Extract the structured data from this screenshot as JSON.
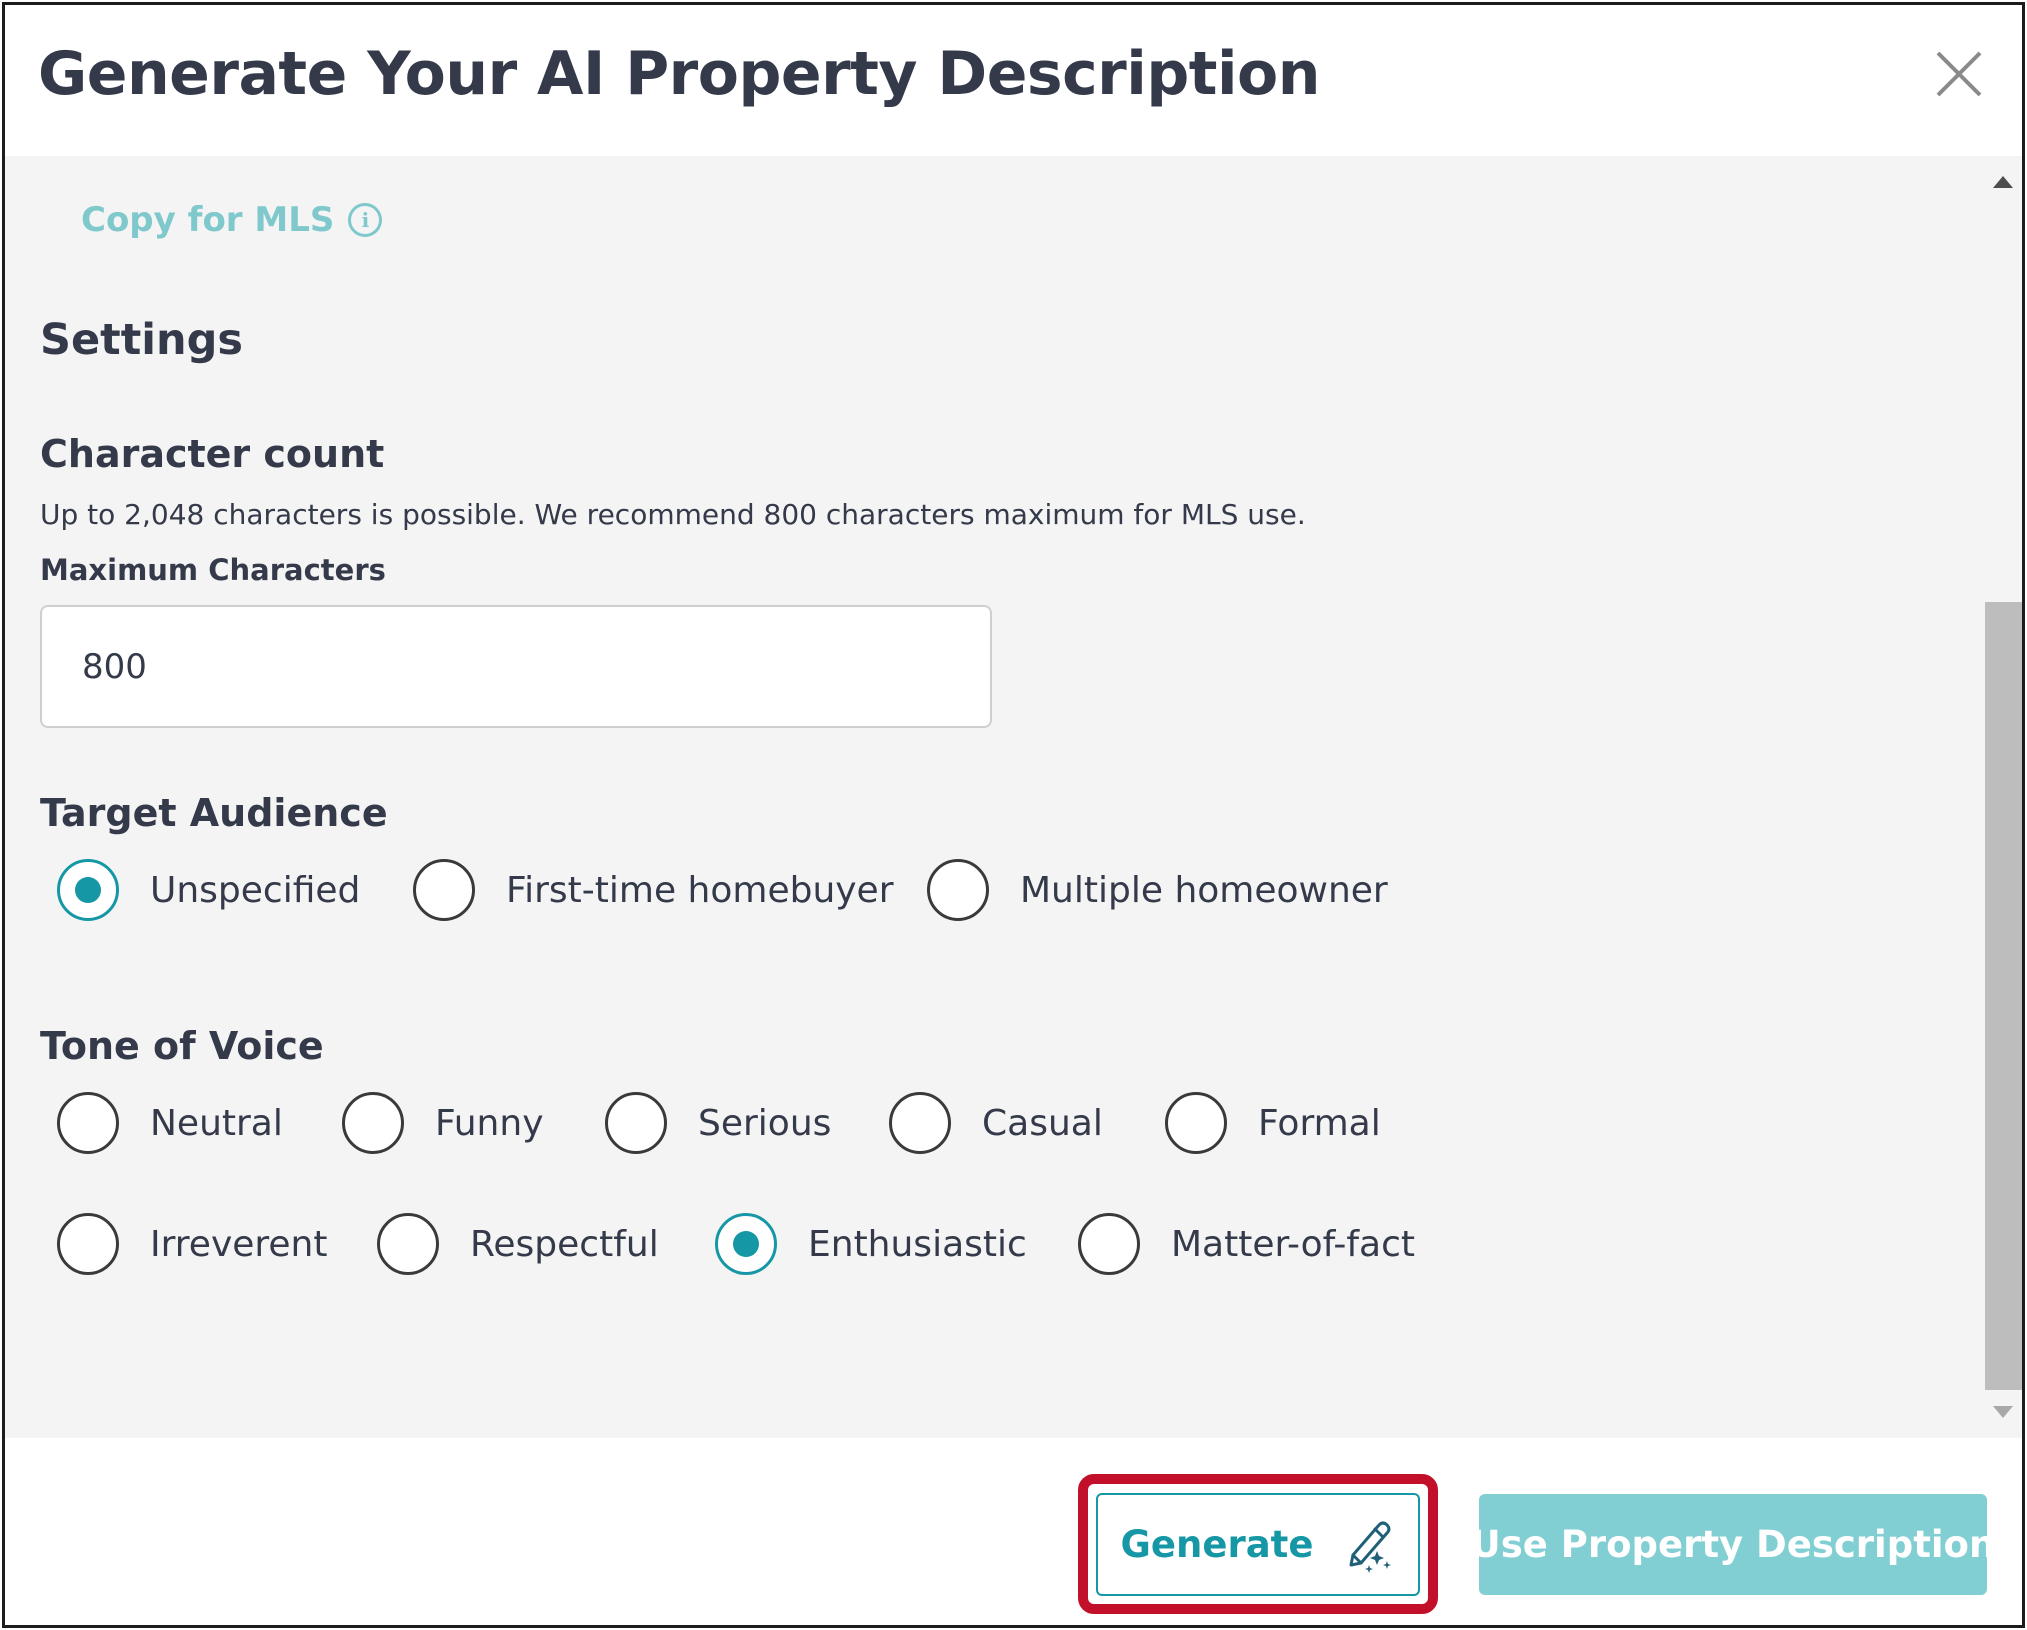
{
  "modal": {
    "title": "Generate Your AI Property Description"
  },
  "body": {
    "copy_link": "Copy for MLS",
    "settings_heading": "Settings",
    "character_count": {
      "heading": "Character count",
      "help_text": "Up to 2,048 characters is possible. We recommend 800 characters maximum for MLS use.",
      "field_label": "Maximum Characters",
      "value": "800"
    },
    "target_audience": {
      "heading": "Target Audience",
      "options": [
        "Unspecified",
        "First-time homebuyer",
        "Multiple homeowner"
      ],
      "selected": "Unspecified"
    },
    "tone_of_voice": {
      "heading": "Tone of Voice",
      "options": [
        "Neutral",
        "Funny",
        "Serious",
        "Casual",
        "Formal",
        "Irreverent",
        "Respectful",
        "Enthusiastic",
        "Matter-of-fact"
      ],
      "selected": "Enthusiastic"
    }
  },
  "footer": {
    "generate_label": "Generate",
    "use_label": "Use Property Description"
  },
  "colors": {
    "accent": "#1597a5",
    "accent_light": "#82cfd3",
    "link": "#7fc8cc",
    "highlight": "#c2102a",
    "text": "#343a4a",
    "body_bg": "#f4f4f4"
  },
  "icons": {
    "close": "close-icon",
    "info": "info-icon",
    "generate": "magic-pen-icon"
  }
}
